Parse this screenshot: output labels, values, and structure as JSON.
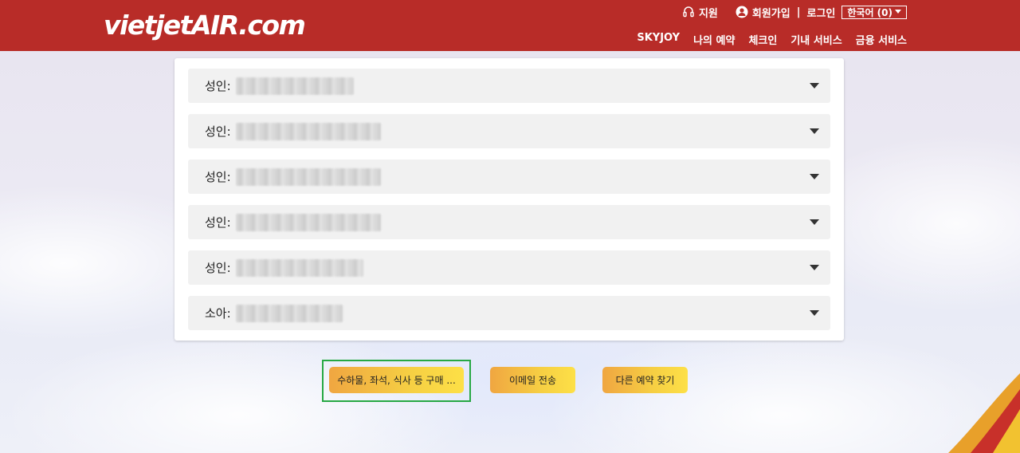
{
  "header": {
    "logo_text": "vietjetAIR.com",
    "top_links": {
      "support": "지원",
      "signup": "회원가입",
      "separator": "|",
      "login": "로그인",
      "language": "한국어 (0)"
    },
    "nav": [
      "SKYJOY",
      "나의 예약",
      "체크인",
      "기내 서비스",
      "금융 서비스"
    ]
  },
  "passengers": [
    {
      "type": "성인:"
    },
    {
      "type": "성인:"
    },
    {
      "type": "성인:"
    },
    {
      "type": "성인:"
    },
    {
      "type": "성인:"
    },
    {
      "type": "소아:"
    }
  ],
  "actions": {
    "purchase_extras": "수하물, 좌석, 식사 등 구매 ...",
    "send_email": "이메일 전송",
    "find_booking": "다른 예약 찾기"
  },
  "colors": {
    "brand_red": "#b82c28",
    "button_gradient_start": "#f0a641",
    "button_gradient_end": "#fde047",
    "focus_green": "#27a844"
  }
}
